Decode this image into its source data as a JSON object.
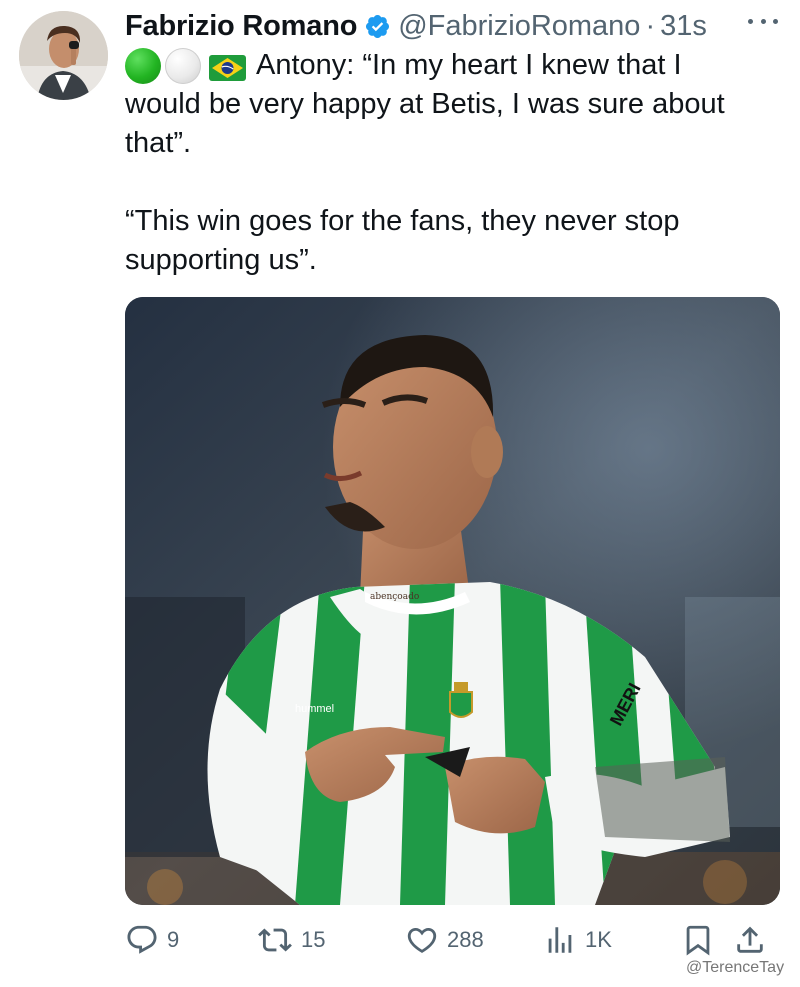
{
  "author": {
    "display_name": "Fabrizio Romano",
    "handle": "@FabrizioRomano",
    "separator": "·",
    "time": "31s",
    "verified_color": "#1d9bf0"
  },
  "tweet": {
    "emoji": [
      "green-circle",
      "white-circle",
      "brazil-flag"
    ],
    "line1_text": "Antony: “In my heart I knew that I",
    "line2_text": "would be very happy at Betis, I was sure about",
    "line3_text": "that”.",
    "para2_line1": "“This win goes for the fans, they never stop",
    "para2_line2": "supporting us”."
  },
  "media": {
    "jersey_sponsor_text": "MERI",
    "jersey_brand_text": "hummel",
    "neck_tattoo_text": "abençoado"
  },
  "actions": {
    "replies": "9",
    "reposts": "15",
    "likes": "288",
    "views": "1K"
  },
  "watermark": "@TerenceTay",
  "colors": {
    "text": "#0f1419",
    "secondary": "#536471",
    "betis_green": "#1f9a47"
  }
}
